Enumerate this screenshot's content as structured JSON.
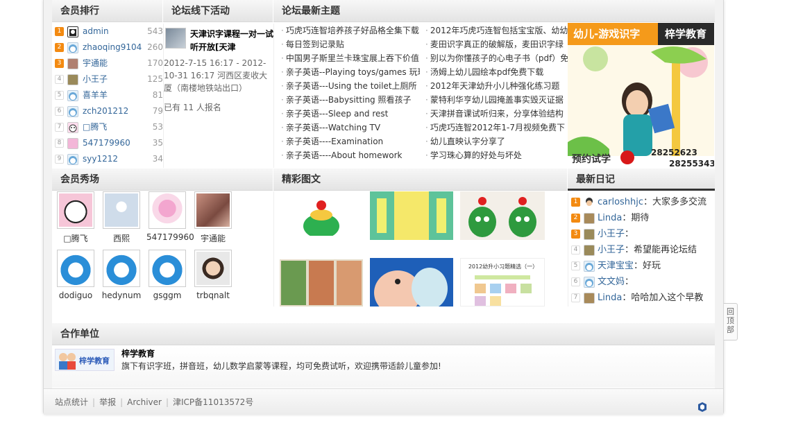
{
  "sections": {
    "rank_title": "会员排行",
    "offline_title": "论坛线下活动",
    "latest_topics_title": "论坛最新主题",
    "member_show_title": "会员秀场",
    "gallery_title": "精彩图文",
    "diary_title": "最新日记",
    "partners_title": "合作单位"
  },
  "rank": [
    {
      "num": "1",
      "name": "admin",
      "count": "543"
    },
    {
      "num": "2",
      "name": "zhaoqing9104",
      "count": "260"
    },
    {
      "num": "3",
      "name": "宇通能",
      "count": "170"
    },
    {
      "num": "4",
      "name": "小王子",
      "count": "125"
    },
    {
      "num": "5",
      "name": "喜羊羊",
      "count": "81"
    },
    {
      "num": "6",
      "name": "zch201212",
      "count": "79"
    },
    {
      "num": "7",
      "name": "□腾飞",
      "count": "53"
    },
    {
      "num": "8",
      "name": "547179960",
      "count": "35"
    },
    {
      "num": "9",
      "name": "syy1212",
      "count": "34"
    }
  ],
  "offline": {
    "title": "天津识字课程一对一试听开放[天津",
    "time": "2012-7-15 16:17 - 2012-10-31 16:17 河西区麦收大厦（南楼地铁站出口）",
    "signup": "已有 11 人报名"
  },
  "topics_left": [
    "巧虎巧连智培养孩子好品格全集下载",
    "每日签到记录贴",
    "中国男子斯里兰卡珠宝展上吞下价值",
    "亲子英语--Playing toys/games 玩玩",
    "亲子英语---Using the toilet上厕所",
    "亲子英语---Babysitting 照看孩子",
    "亲子英语---Sleep and rest",
    "亲子英语---Watching TV",
    "亲子英语----Examination",
    "亲子英语----About homework"
  ],
  "topics_right": [
    "2012年巧虎巧连智包括宝宝版、幼幼",
    "麦田识字真正的破解版，麦田识字绿",
    "别以为你懂孩子的心电子书（pdf）免",
    "汤姆上幼儿园绘本pdf免费下载",
    "2012年天津幼升小儿种强化练习题",
    "蒙特利华亨幼儿园掩盖事实毁灭证据",
    "天津拼音课试听归来，分享体验结构",
    "巧虎巧连智2012年1-7月视频免费下",
    "幼儿直映认字分享了",
    "学习珠心算的好处与坏处"
  ],
  "ad": {
    "left": "幼儿-游戏识字",
    "right": "梓学教育",
    "trial": "预约试学",
    "phone1": "28252623",
    "phone2": "28255343"
  },
  "member_show": [
    {
      "name": "□腾飞"
    },
    {
      "name": "西熙"
    },
    {
      "name": "547179960"
    },
    {
      "name": "宇通能"
    },
    {
      "name": "dodiguo"
    },
    {
      "name": "hedynum"
    },
    {
      "name": "gsggm"
    },
    {
      "name": "trbqnalt"
    }
  ],
  "diary": [
    {
      "num": "1",
      "user": "carloshhjc",
      "text": "：大家多多交流"
    },
    {
      "num": "2",
      "user": "Linda",
      "text": "：期待"
    },
    {
      "num": "3",
      "user": "小王子",
      "text": "："
    },
    {
      "num": "4",
      "user": "小王子",
      "text": "：希望能再论坛结"
    },
    {
      "num": "5",
      "user": "天津宝宝",
      "text": "：好玩"
    },
    {
      "num": "6",
      "user": "文文妈",
      "text": "："
    },
    {
      "num": "7",
      "user": "Linda",
      "text": "：哈哈加入这个早教"
    }
  ],
  "partner": {
    "logo_text": "梓学教育",
    "name": "梓学教育",
    "desc": "旗下有识字班，拼音班，幼儿数学启蒙等课程，均可免费试听，欢迎携带适龄儿童参加!"
  },
  "gallery_caption": "2012幼升小习题精选（一）",
  "footer": {
    "stats": "站点统计",
    "report": "举报",
    "archiver": "Archiver",
    "icp": "津ICP备11013572号"
  },
  "back_top": "回顶部",
  "colors": {
    "accent": "#f38a11",
    "link": "#336699",
    "header_bg": "#e9e9e9"
  }
}
